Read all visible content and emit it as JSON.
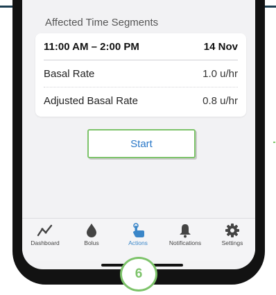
{
  "section": {
    "label": "Affected Time Segments"
  },
  "segment": {
    "range": "11:00 AM – 2:00 PM",
    "date": "14 Nov",
    "rows": [
      {
        "label": "Basal Rate",
        "value": "1.0 u/hr"
      },
      {
        "label": "Adjusted Basal Rate",
        "value": "0.8 u/hr"
      }
    ]
  },
  "start_button": {
    "label": "Start"
  },
  "tabs": [
    {
      "label": "Dashboard",
      "icon": "dashboard-trend-icon",
      "active": false
    },
    {
      "label": "Bolus",
      "icon": "drop-icon",
      "active": false
    },
    {
      "label": "Actions",
      "icon": "hand-tap-icon",
      "active": true
    },
    {
      "label": "Notifications",
      "icon": "bell-icon",
      "active": false
    },
    {
      "label": "Settings",
      "icon": "gear-icon",
      "active": false
    }
  ],
  "step_badge": {
    "number": "6"
  },
  "colors": {
    "accent": "#3a86c8",
    "highlight": "#7dc36a",
    "frame": "#121212"
  }
}
